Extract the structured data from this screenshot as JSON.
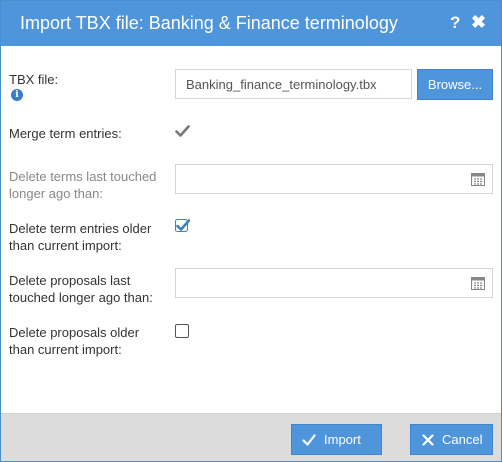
{
  "dialog": {
    "title": "Import TBX file: Banking & Finance terminology",
    "help_symbol": "?",
    "close_symbol": "✖"
  },
  "form": {
    "tbx_file_label": "TBX file:",
    "tbx_file_value": "Banking_finance_terminology.tbx",
    "browse_label": "Browse...",
    "merge_label": "Merge term entries:",
    "merge_checked": true,
    "delete_terms_label_line1": "Delete terms last touched",
    "delete_terms_label_line2": "longer ago than:",
    "delete_entries_older_line1": "Delete term entries older",
    "delete_entries_older_line2": "than current import:",
    "delete_entries_older_checked": true,
    "delete_proposals_line1": "Delete proposals last",
    "delete_proposals_line2": "touched longer ago than:",
    "delete_proposals_older_line1": "Delete proposals older",
    "delete_proposals_older_line2": "than current import:",
    "delete_proposals_older_checked": false
  },
  "footer": {
    "import_label": "Import",
    "cancel_label": "Cancel"
  },
  "colors": {
    "accent": "#4f95dc",
    "checkbox_checked": "#3a7fc6",
    "checkbox_disabled": "#777777"
  }
}
